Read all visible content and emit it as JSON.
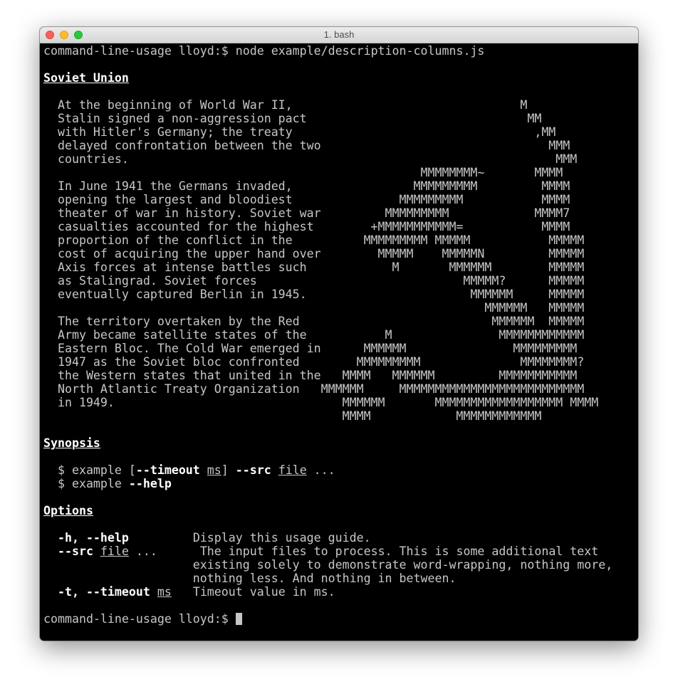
{
  "window": {
    "title": "1. bash"
  },
  "command": {
    "prompt": "command-line-usage lloyd:$ ",
    "text": "node example/description-columns.js"
  },
  "section1": {
    "heading": "Soviet Union",
    "lines": [
      {
        "desc": "  At the beginning of World War II,",
        "art": "                                                                   M"
      },
      {
        "desc": "  Stalin signed a non-aggression pact",
        "art": "                                                                    MM"
      },
      {
        "desc": "  with Hitler's Germany; the treaty",
        "art": "                                                                     ,MM"
      },
      {
        "desc": "  delayed confrontation between the two",
        "art": "                                                                       MMM"
      },
      {
        "desc": "  countries.",
        "art": "                                                                        MMM"
      },
      {
        "desc": "",
        "art": "                                                     MMMMMMMM~       MMMM"
      },
      {
        "desc": "  In June 1941 the Germans invaded,",
        "art": "                                                    MMMMMMMMM         MMMM"
      },
      {
        "desc": "  opening the largest and bloodiest",
        "art": "                                                  MMMMMMMMM           MMMM"
      },
      {
        "desc": "  theater of war in history. Soviet war",
        "art": "                                                MMMMMMMMM            MMMM7"
      },
      {
        "desc": "  casualties accounted for the highest",
        "art": "                                              +MMMMMMMMMMM=           MMMM"
      },
      {
        "desc": "  proportion of the conflict in the",
        "art": "                                             MMMMMMMMM MMMMM           MMMMM"
      },
      {
        "desc": "  cost of acquiring the upper hand over",
        "art": "                                               MMMMM    MMMMMN         MMMMM"
      },
      {
        "desc": "  Axis forces at intense battles such",
        "art": "                                                 M       MMMMMM        MMMMM"
      },
      {
        "desc": "  as Stalingrad. Soviet forces",
        "art": "                                                           MMMMM?      MMMMM"
      },
      {
        "desc": "  eventually captured Berlin in 1945.",
        "art": "                                                            MMMMMM     MMMMM"
      },
      {
        "desc": "",
        "art": "                                                              MMMMMM   MMMMM"
      },
      {
        "desc": "  The territory overtaken by the Red",
        "art": "                                                               MMMMMM  MMMMM"
      },
      {
        "desc": "  Army became satellite states of the",
        "art": "                                                M               MMMMMMMMMMMM"
      },
      {
        "desc": "  Eastern Bloc. The Cold War emerged in",
        "art": "                                             MMMMMM               MMMMMMMMM"
      },
      {
        "desc": "  1947 as the Soviet bloc confronted",
        "art": "                                            MMMMMMMMM              MMMMMMMM?"
      },
      {
        "desc": "  the Western states that united in the",
        "art": "                                          MMMM   MMMMMM         MMMMMMMMMMM"
      },
      {
        "desc": "  North Atlantic Treaty Organization",
        "art": "                                       MMMMMM     MMMMMMMMMMMMMMMMMMMMMMMMMM"
      },
      {
        "desc": "  in 1949.",
        "art": "                                          MMMMMM       MMMMMMMMMMMMMMMMMM MMMM"
      },
      {
        "desc": "",
        "art": "                                          MMMM            MMMMMMMMMMMM"
      }
    ]
  },
  "synopsis": {
    "heading": "Synopsis",
    "line1": {
      "prefix": "  $ example [",
      "timeout_flag": "--timeout",
      "space": " ",
      "timeout_arg": "ms",
      "mid": "] ",
      "src_flag": "--src",
      "src_space": " ",
      "src_arg": "file",
      "suffix": " ..."
    },
    "line2": {
      "prefix": "  $ example ",
      "help_flag": "--help"
    }
  },
  "options": {
    "heading": "Options",
    "rows": [
      {
        "flags": "-h, --help",
        "arg": "",
        "pad": "         ",
        "desc": "Display this usage guide."
      },
      {
        "flags": "--src",
        "arg": "file",
        "pad": " ...      ",
        "desc": "The input files to process. This is some additional text"
      },
      {
        "flags": "",
        "arg": "",
        "pad": "",
        "desc": "existing solely to demonstrate word-wrapping, nothing more,"
      },
      {
        "flags": "",
        "arg": "",
        "pad": "",
        "desc": "nothing less. And nothing in between."
      },
      {
        "flags": "-t, --timeout",
        "arg": "ms",
        "pad": "   ",
        "desc": "Timeout value in ms."
      }
    ]
  },
  "final_prompt": {
    "prompt": "command-line-usage lloyd:$ "
  }
}
